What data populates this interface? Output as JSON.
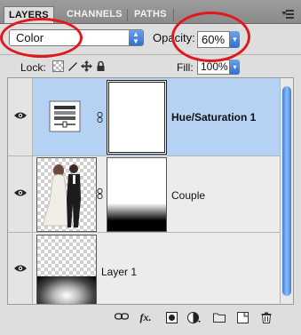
{
  "tabs": [
    {
      "label": "LAYERS",
      "active": true
    },
    {
      "label": "CHANNELS",
      "active": false
    },
    {
      "label": "PATHS",
      "active": false
    }
  ],
  "blend_mode": {
    "value": "Color"
  },
  "opacity": {
    "label": "Opacity:",
    "value": "60%"
  },
  "lock": {
    "label": "Lock:"
  },
  "fill": {
    "label": "Fill:",
    "value": "100%"
  },
  "layers": [
    {
      "name": "Hue/Saturation 1",
      "selected": true,
      "type": "adjustment",
      "visible": true
    },
    {
      "name": "Couple",
      "selected": false,
      "type": "pixel-with-mask",
      "visible": true
    },
    {
      "name": "Layer 1",
      "selected": false,
      "type": "pixel",
      "visible": true
    }
  ],
  "toolbar_icons": [
    "link-layers-icon",
    "layer-style-icon",
    "add-mask-icon",
    "adjustment-layer-icon",
    "new-group-icon",
    "new-layer-icon",
    "delete-layer-icon"
  ],
  "colors": {
    "selection": "#b5d2f5",
    "annotation": "#e0191e",
    "accent_blue": "#2f6fd1"
  }
}
